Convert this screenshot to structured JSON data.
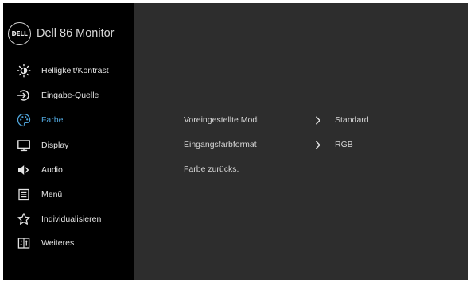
{
  "brand": {
    "logo_text": "DELL",
    "model_name": "Dell 86 Monitor"
  },
  "menu": {
    "active_index": 2,
    "items": [
      {
        "label": "Helligkeit/Kontrast",
        "icon": "brightness-icon"
      },
      {
        "label": "Eingabe-Quelle",
        "icon": "input-source-icon"
      },
      {
        "label": "Farbe",
        "icon": "color-palette-icon"
      },
      {
        "label": "Display",
        "icon": "display-icon"
      },
      {
        "label": "Audio",
        "icon": "speaker-icon"
      },
      {
        "label": "Menü",
        "icon": "menu-icon"
      },
      {
        "label": "Individualisieren",
        "icon": "star-icon"
      },
      {
        "label": "Weiteres",
        "icon": "others-icon"
      }
    ]
  },
  "options": [
    {
      "label": "Voreingestellte Modi",
      "value": "Standard",
      "has_submenu": true
    },
    {
      "label": "Eingangsfarbformat",
      "value": "RGB",
      "has_submenu": true
    },
    {
      "label": "Farbe zurücks.",
      "value": "",
      "has_submenu": false
    }
  ],
  "colors": {
    "sidebar_background": "#000000",
    "main_background": "#2d2d2d",
    "active_item": "#4fa3d8",
    "text": "#e3e3e3"
  }
}
